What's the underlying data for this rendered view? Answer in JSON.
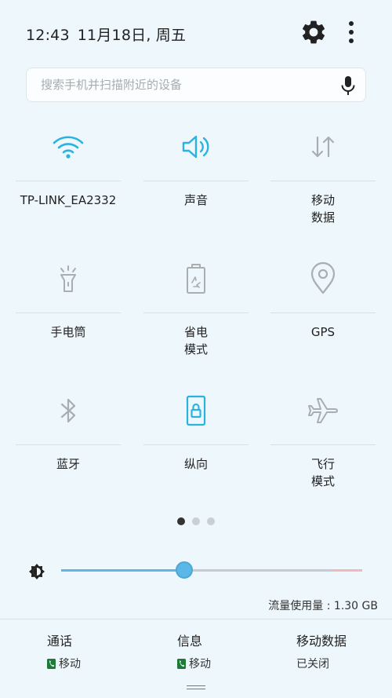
{
  "status": {
    "time": "12:43",
    "date": "11月18日, 周五"
  },
  "search": {
    "placeholder": "搜索手机并扫描附近的设备"
  },
  "tiles": [
    {
      "label": "TP-LINK_EA2332",
      "icon": "wifi-icon",
      "active": true
    },
    {
      "label": "声音",
      "icon": "speaker-icon",
      "active": true
    },
    {
      "label": "移动\n数据",
      "icon": "mobile-data-icon",
      "active": false
    },
    {
      "label": "手电筒",
      "icon": "flashlight-icon",
      "active": false
    },
    {
      "label": "省电\n模式",
      "icon": "battery-saver-icon",
      "active": false
    },
    {
      "label": "GPS",
      "icon": "location-icon",
      "active": false
    },
    {
      "label": "蓝牙",
      "icon": "bluetooth-icon",
      "active": false
    },
    {
      "label": "纵向",
      "icon": "portrait-lock-icon",
      "active": true
    },
    {
      "label": "飞行\n模式",
      "icon": "airplane-icon",
      "active": false
    }
  ],
  "pager": {
    "pages": 3,
    "current": 1
  },
  "brightness": {
    "level": 0.41
  },
  "data_usage": "流量使用量 : 1.30 GB",
  "sim_panel": [
    {
      "title": "通话",
      "sub": "移动",
      "badge": true
    },
    {
      "title": "信息",
      "sub": "移动",
      "badge": true
    },
    {
      "title": "移动数据",
      "sub": "已关闭",
      "badge": false
    }
  ],
  "colors": {
    "active": "#2bb3e0",
    "inactive": "#a9aeb1",
    "background": "#eef7fc",
    "sim_badge": "#1f7a3a"
  }
}
